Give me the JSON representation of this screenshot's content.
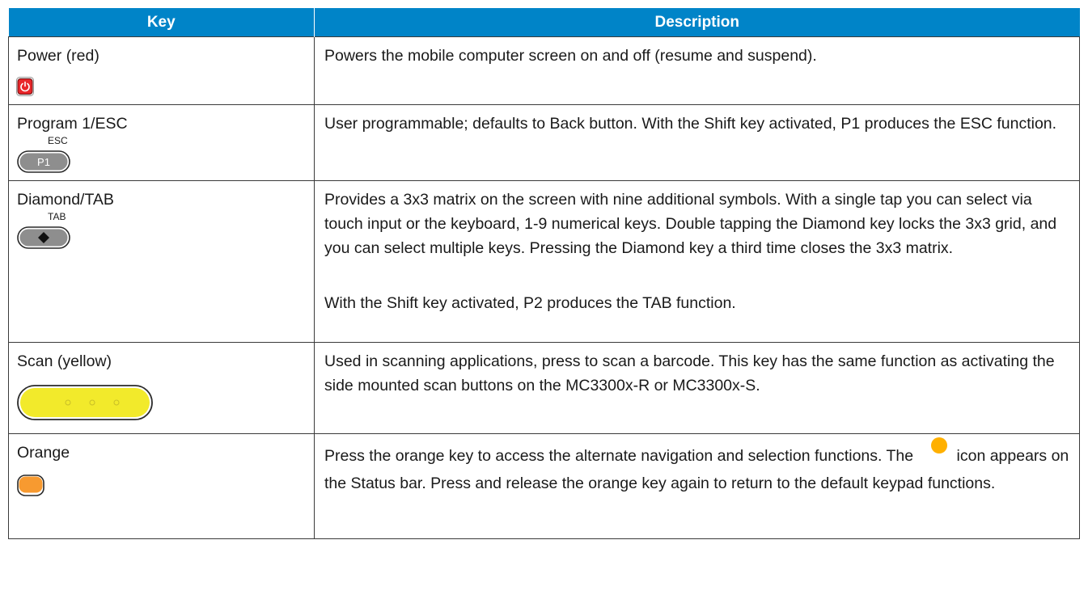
{
  "header": {
    "key": "Key",
    "description": "Description"
  },
  "rows": [
    {
      "key": "Power (red)",
      "icon": "power-key-icon",
      "description": [
        "Powers the mobile computer screen on and off (resume and suspend)."
      ]
    },
    {
      "key": "Program 1/ESC",
      "icon": "p1-key-icon",
      "icon_label": "P1",
      "icon_sup": "ESC",
      "description": [
        "User programmable; defaults to Back button. With the Shift key activated, P1 produces the ESC function."
      ]
    },
    {
      "key": "Diamond/TAB",
      "icon": "diamond-key-icon",
      "icon_sup": "TAB",
      "description": [
        "Provides a 3x3 matrix on the screen with nine additional symbols. With a single tap you can select via touch input or the keyboard, 1-9 numerical keys. Double tapping the Diamond key locks the 3x3 grid, and you can select multiple keys. Pressing the Diamond key a third time closes the 3x3 matrix.",
        "With the Shift key activated, P2 produces the TAB function."
      ]
    },
    {
      "key": "Scan (yellow)",
      "icon": "scan-key-icon",
      "description": [
        "Used in scanning applications, press to scan a barcode. This key has the same function as activating the side mounted scan buttons on the MC3300x-R or MC3300x-S."
      ]
    },
    {
      "key": "Orange",
      "icon": "orange-key-icon",
      "description_parts": {
        "before": "Press the orange key to access the alternate navigation and selection functions. The",
        "after": "icon appears on the Status bar. Press and release the orange key again to return to the default keypad functions."
      }
    }
  ],
  "colors": {
    "header_bg": "#0084c8",
    "power_red": "#e8262a",
    "scan_yellow": "#f2ea2b",
    "orange": "#f79a30",
    "status_dot": "#ffb000"
  }
}
